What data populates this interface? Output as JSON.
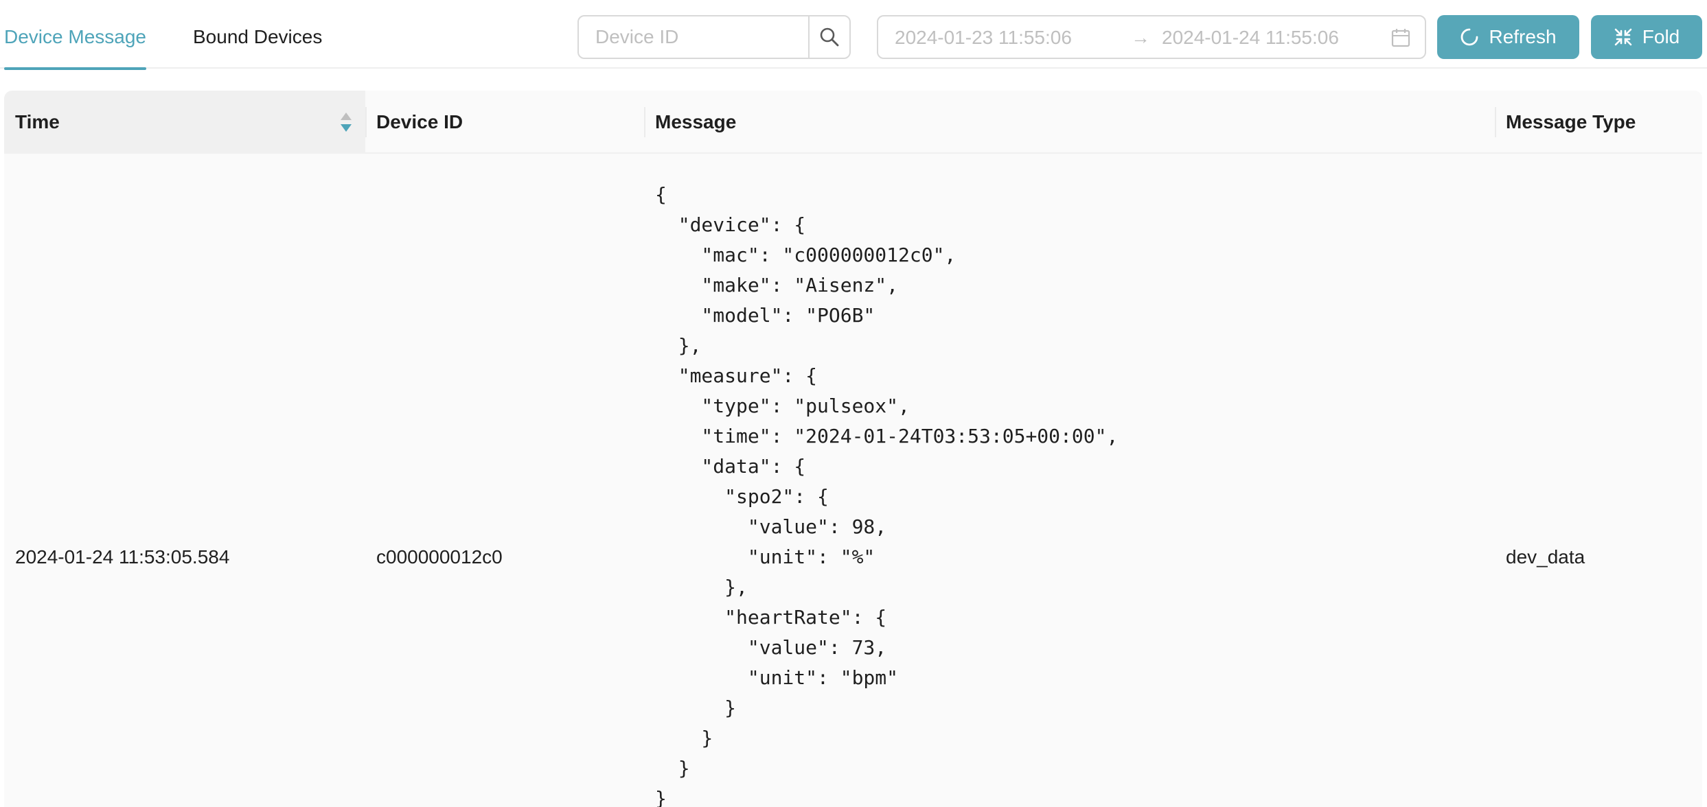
{
  "tabs": [
    {
      "label": "Device Message",
      "active": true
    },
    {
      "label": "Bound Devices",
      "active": false
    }
  ],
  "search": {
    "placeholder": "Device ID",
    "value": ""
  },
  "date_range": {
    "start": "2024-01-23 11:55:06",
    "separator": "→",
    "end": "2024-01-24 11:55:06"
  },
  "buttons": {
    "refresh_label": "Refresh",
    "fold_label": "Fold"
  },
  "colors": {
    "accent": "#4ea4b9",
    "button_bg": "#57a7b8"
  },
  "icons": {
    "search": "search-icon",
    "calendar": "calendar-icon",
    "refresh": "refresh-icon",
    "fold": "compress-icon",
    "sort": "sort-icon"
  },
  "table": {
    "columns": [
      "Time",
      "Device ID",
      "Message",
      "Message Type"
    ],
    "rows": [
      {
        "time": "2024-01-24 11:53:05.584",
        "device_id": "c000000012c0",
        "message": "{\n  \"device\": {\n    \"mac\": \"c000000012c0\",\n    \"make\": \"Aisenz\",\n    \"model\": \"PO6B\"\n  },\n  \"measure\": {\n    \"type\": \"pulseox\",\n    \"time\": \"2024-01-24T03:53:05+00:00\",\n    \"data\": {\n      \"spo2\": {\n        \"value\": 98,\n        \"unit\": \"%\"\n      },\n      \"heartRate\": {\n        \"value\": 73,\n        \"unit\": \"bpm\"\n      }\n    }\n  }\n}",
        "message_type": "dev_data"
      }
    ]
  }
}
